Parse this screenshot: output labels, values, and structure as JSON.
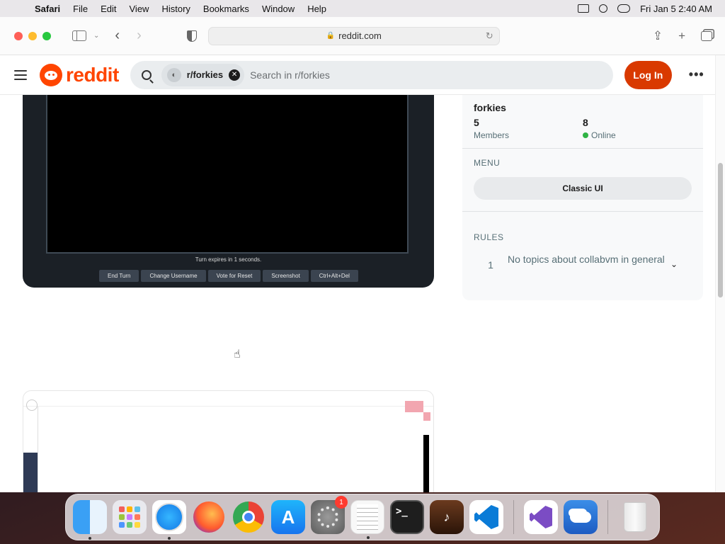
{
  "menubar": {
    "app_name": "Safari",
    "items": [
      "File",
      "Edit",
      "View",
      "History",
      "Bookmarks",
      "Window",
      "Help"
    ],
    "datetime": "Fri Jan 5  2:40 AM"
  },
  "browser": {
    "url": "reddit.com"
  },
  "reddit": {
    "logo_text": "reddit",
    "search_chip": "r/forkies",
    "search_placeholder": "Search in r/forkies",
    "login_label": "Log In",
    "more_label": "•••"
  },
  "post": {
    "vm_status": "Turn expires in 1 seconds.",
    "vm_buttons": [
      "End Turn",
      "Change Username",
      "Vote for Reset",
      "Screenshot",
      "Ctrl+Alt+Del"
    ]
  },
  "sidebar": {
    "community_name": "forkies",
    "members_count": "5",
    "members_label": "Members",
    "online_count": "8",
    "online_label": "Online",
    "menu_heading": "MENU",
    "classic_ui_label": "Classic UI",
    "rules_heading": "RULES",
    "rules": [
      {
        "number": "1",
        "text": "No topics about collabvm in general"
      }
    ]
  },
  "dock": {
    "apps": [
      {
        "name": "Finder",
        "icon": "finder-icon",
        "running": true
      },
      {
        "name": "Launchpad",
        "icon": "launchpad-icon",
        "running": false
      },
      {
        "name": "Safari",
        "icon": "safari-icon",
        "running": true
      },
      {
        "name": "Firefox",
        "icon": "firefox-icon",
        "running": false
      },
      {
        "name": "Chrome",
        "icon": "chrome-icon",
        "running": false
      },
      {
        "name": "App Store",
        "icon": "appstore-icon",
        "running": false
      },
      {
        "name": "System Settings",
        "icon": "settings-icon",
        "running": false,
        "badge": "1"
      },
      {
        "name": "TextEdit",
        "icon": "textedit-icon",
        "running": true
      },
      {
        "name": "Terminal",
        "icon": "terminal-icon",
        "running": false
      },
      {
        "name": "GarageBand",
        "icon": "garageband-icon",
        "running": false
      },
      {
        "name": "VS Code",
        "icon": "vscode-icon",
        "running": false
      },
      {
        "name": "Visual Studio",
        "icon": "visualstudio-icon",
        "running": false
      },
      {
        "name": "Weather",
        "icon": "weather-icon",
        "running": false
      },
      {
        "name": "Trash",
        "icon": "trash-icon",
        "running": false
      }
    ]
  },
  "colors": {
    "reddit_orange": "#ff4500",
    "login_button": "#d93900",
    "online_dot": "#2fb344"
  }
}
